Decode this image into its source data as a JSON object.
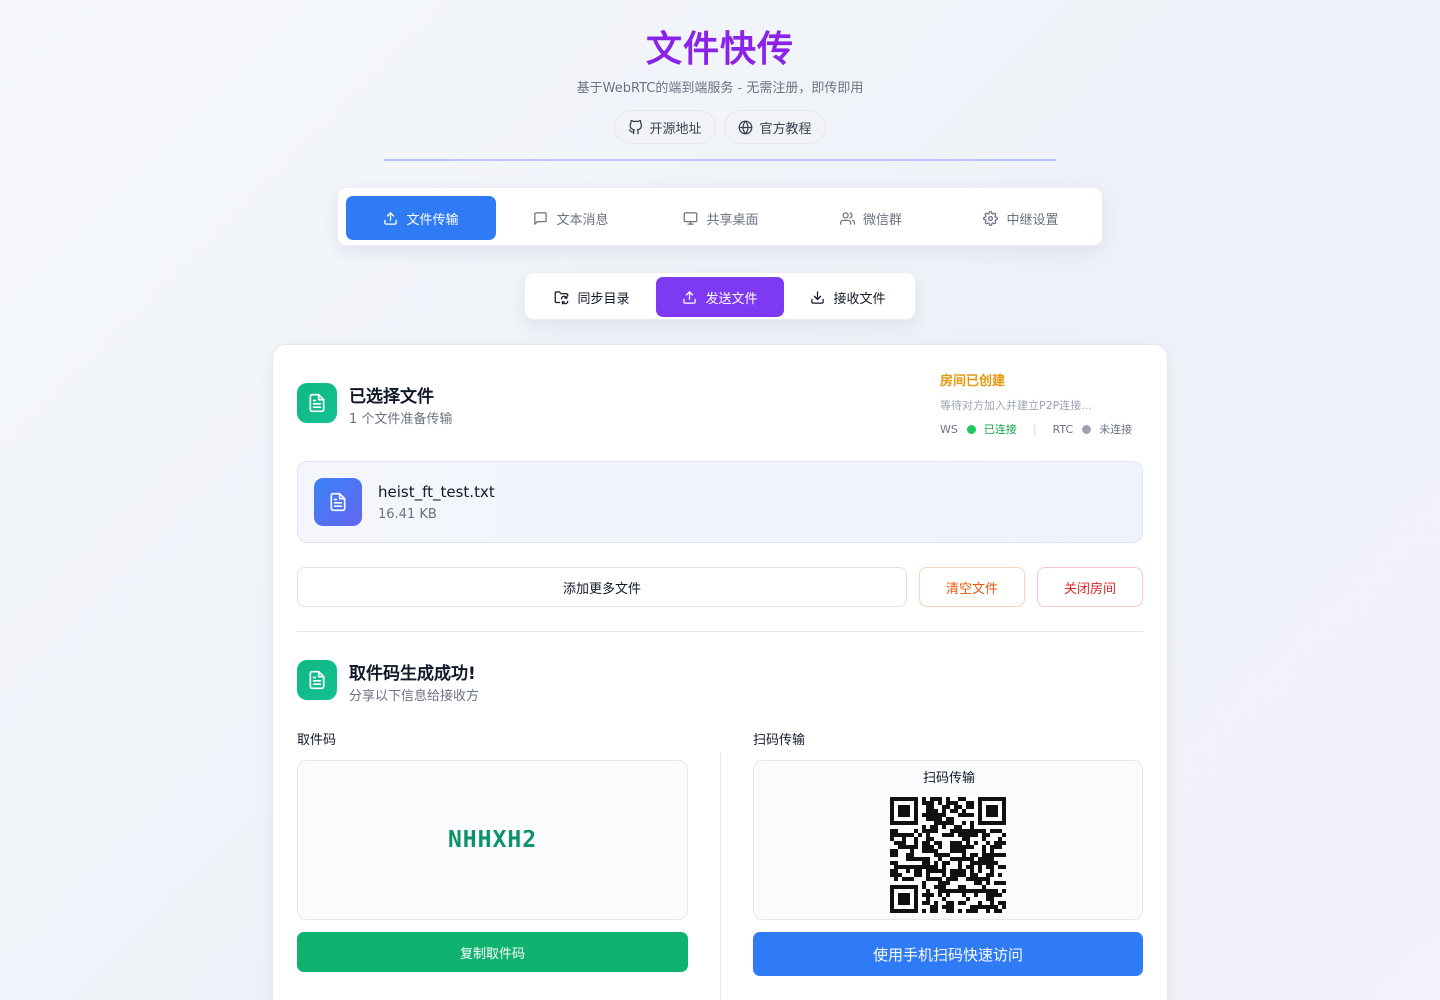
{
  "header": {
    "title": "文件快传",
    "subtitle": "基于WebRTC的端到端服务 - 无需注册，即传即用",
    "links": [
      {
        "label": "开源地址",
        "icon": "github-icon"
      },
      {
        "label": "官方教程",
        "icon": "globe-icon"
      }
    ]
  },
  "main_tabs": [
    {
      "label": "文件传输",
      "icon": "upload-icon",
      "active": true
    },
    {
      "label": "文本消息",
      "icon": "message-icon",
      "active": false
    },
    {
      "label": "共享桌面",
      "icon": "monitor-icon",
      "active": false
    },
    {
      "label": "微信群",
      "icon": "users-icon",
      "active": false
    },
    {
      "label": "中继设置",
      "icon": "gear-icon",
      "active": false
    }
  ],
  "sub_tabs": [
    {
      "label": "同步目录",
      "icon": "folder-sync-icon",
      "active": false
    },
    {
      "label": "发送文件",
      "icon": "upload-icon",
      "active": true
    },
    {
      "label": "接收文件",
      "icon": "download-icon",
      "active": false
    }
  ],
  "selected": {
    "title": "已选择文件",
    "subtitle": "1 个文件准备传输"
  },
  "room": {
    "title": "房间已创建",
    "subtitle": "等待对方加入并建立P2P连接...",
    "ws_label": "WS",
    "ws_status": "已连接",
    "separator": "|",
    "rtc_label": "RTC",
    "rtc_status": "未连接",
    "colors": {
      "connected": "#22c55e",
      "disconnected": "#9ca3af",
      "title": "#e5970c"
    }
  },
  "file": {
    "name": "heist_ft_test.txt",
    "size": "16.41 KB"
  },
  "actions": {
    "add": "添加更多文件",
    "clear": "清空文件",
    "close_room": "关闭房间"
  },
  "success": {
    "title": "取件码生成成功!",
    "subtitle": "分享以下信息给接收方"
  },
  "pickup": {
    "label": "取件码",
    "code": "NHHXH2",
    "copy_button": "复制取件码"
  },
  "scan": {
    "label": "扫码传输",
    "box_title": "扫码传输",
    "button": "使用手机扫码快速访问"
  }
}
